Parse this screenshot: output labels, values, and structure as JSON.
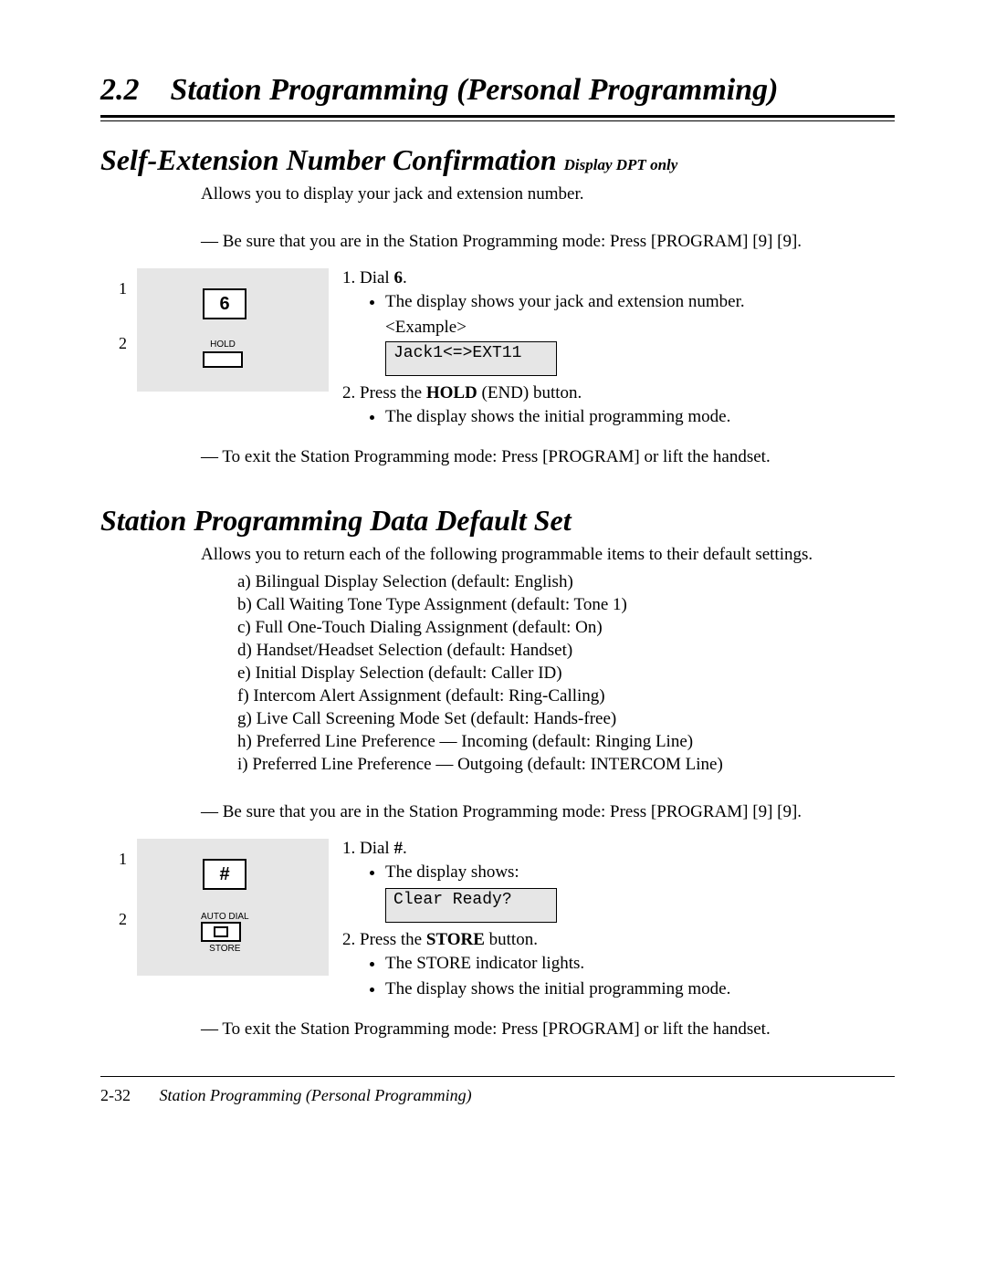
{
  "header": {
    "number": "2.2",
    "title": "Station Programming (Personal Programming)"
  },
  "section1": {
    "heading": "Self-Extension Number Confirmation",
    "note": "Display DPT only",
    "intro": "Allows you to display your jack and extension number.",
    "precond": "— Be sure that you are in the Station Programming mode: Press [PROGRAM] [9] [9].",
    "diag_num1": "1",
    "diag_num2": "2",
    "key_label": "6",
    "hold_label": "HOLD",
    "step1_pre": "Dial ",
    "step1_bold": "6",
    "step1_post": ".",
    "step1_b1": "The display shows your jack and extension number.",
    "example_label": "<Example>",
    "display": "Jack1<=>EXT11",
    "step2_pre": "Press the ",
    "step2_bold": "HOLD",
    "step2_post": " (END) button.",
    "step2_b1": "The display shows the initial programming mode.",
    "exit": "— To exit the Station Programming mode: Press [PROGRAM] or lift the handset."
  },
  "section2": {
    "heading": "Station Programming Data Default Set",
    "intro": "Allows you to return each of the following programmable items to their default settings.",
    "items": {
      "a": "a)  Bilingual Display Selection (default: English)",
      "b": "b)  Call Waiting Tone Type Assignment (default: Tone 1)",
      "c": "c)  Full One-Touch Dialing Assignment (default: On)",
      "d": "d)  Handset/Headset Selection (default: Handset)",
      "e": "e)  Initial Display Selection (default: Caller ID)",
      "f": "f)  Intercom Alert Assignment (default: Ring-Calling)",
      "g": "g)  Live Call Screening Mode Set (default: Hands-free)",
      "h": "h)  Preferred Line Preference — Incoming (default: Ringing Line)",
      "i": "i)  Preferred Line Preference — Outgoing (default: INTERCOM Line)"
    },
    "precond": "— Be sure that you are in the Station Programming mode: Press [PROGRAM] [9] [9].",
    "diag_num1": "1",
    "diag_num2": "2",
    "key_label": "#",
    "autodial_label": "AUTO DIAL",
    "store_label": "STORE",
    "step1_pre": "Dial ",
    "step1_bold": "#",
    "step1_post": ".",
    "step1_b1": "The display shows:",
    "display": "Clear Ready?",
    "step2_pre": "Press the ",
    "step2_bold": "STORE",
    "step2_post": " button.",
    "step2_b1": "The STORE indicator lights.",
    "step2_b2": "The display shows the initial programming mode.",
    "exit": "— To exit the Station Programming mode: Press [PROGRAM] or lift the handset."
  },
  "footer": {
    "page": "2-32",
    "title": "Station Programming (Personal Programming)"
  }
}
